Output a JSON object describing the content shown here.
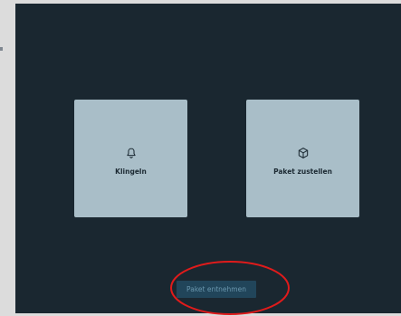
{
  "tiles": [
    {
      "label": "Klingeln",
      "icon": "bell-icon"
    },
    {
      "label": "Paket zustellen",
      "icon": "package-icon"
    }
  ],
  "action_button": {
    "label": "Paket entnehmen",
    "state": "disabled"
  },
  "highlight": {
    "shape": "ellipse",
    "color": "#e01b1b",
    "target": "action-button"
  },
  "colors": {
    "background": "#1a2730",
    "tile": "#a9bec8",
    "tile_text": "#1c2a33",
    "button_bg": "#21455a",
    "button_text": "#6a97ae"
  }
}
